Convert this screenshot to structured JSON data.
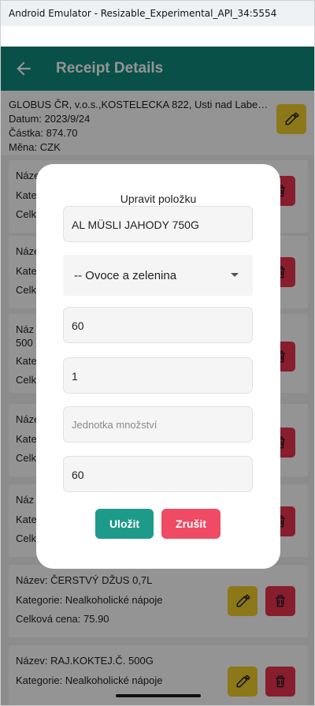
{
  "window": {
    "title": "Android Emulator - Resizable_Experimental_API_34:5554"
  },
  "appbar": {
    "title": "Receipt Details"
  },
  "receipt": {
    "store": "GLOBUS ČR, v.o.s.,KOSTELECKA 822, Usti nad Labem...",
    "date": "Datum: 2023/9/24",
    "amount": "Částka: 874.70",
    "currency": "Měna: CZK"
  },
  "items": [
    {
      "name": "Název:",
      "category": "Kate",
      "total": "Celk"
    },
    {
      "name": "Název:",
      "category": "Kate",
      "total": "Celk"
    },
    {
      "name": "Náz",
      "name_line2": "500",
      "category": "Kate",
      "total": "Celk"
    },
    {
      "name": "Název:",
      "category": "Kate",
      "total": "Celk"
    },
    {
      "name": "Náz",
      "category": "Kate",
      "total": "Celk"
    },
    {
      "name": "Název: ČERSTVÝ DŽUS 0,7L",
      "category": "Kategorie: Nealkoholické nápoje",
      "total": "Celková cena: 75.90"
    },
    {
      "name": "Název: RAJ.KOKTEJ.Č. 500G",
      "category": "Kategorie: Nealkoholické nápoje",
      "total": ""
    }
  ],
  "dialog": {
    "title": "Upravit položku",
    "name_value": "AL MÜSLI JAHODY 750G",
    "category_value": "-- Ovoce a zelenina",
    "price_value": "60",
    "quantity_value": "1",
    "unit_placeholder": "Jednotka množství",
    "total_value": "60",
    "save_label": "Uložit",
    "cancel_label": "Zrušit"
  },
  "colors": {
    "appbar": "#0f8a7d",
    "edit": "#f2cf2c",
    "delete": "#e8334f",
    "save": "#1e9a8b",
    "cancel": "#ef4b64"
  },
  "icons": [
    "back-arrow-icon",
    "edit-icon",
    "trash-icon",
    "dropdown-arrow-icon"
  ]
}
